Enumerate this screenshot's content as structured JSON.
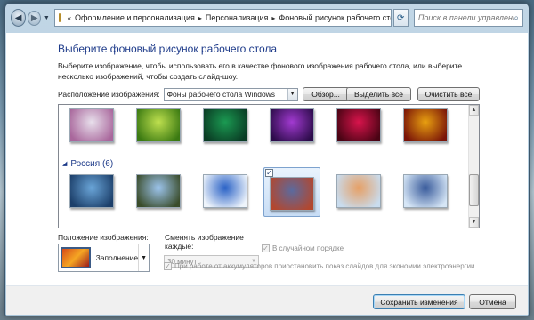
{
  "nav": {
    "breadcrumb": [
      "Оформление и персонализация",
      "Персонализация",
      "Фоновый рисунок рабочего стола"
    ],
    "search_placeholder": "Поиск в панели управления"
  },
  "header": {
    "title": "Выберите фоновый рисунок рабочего стола",
    "description": "Выберите изображение, чтобы использовать его в качестве фонового изображения рабочего стола, или выберите несколько изображений, чтобы создать слайд-шоу."
  },
  "location": {
    "label": "Расположение изображения:",
    "value": "Фоны рабочего стола Windows",
    "browse_label": "Обзор...",
    "select_all_label": "Выделить все",
    "clear_all_label": "Очистить все"
  },
  "gallery": {
    "group_title": "Россия (6)",
    "row1": [
      {
        "name": "white-flower",
        "colors": [
          "#e8e0ec",
          "#a9679c"
        ]
      },
      {
        "name": "green-succulent",
        "colors": [
          "#bfe04f",
          "#3b7a12"
        ]
      },
      {
        "name": "green-leaves",
        "colors": [
          "#1b9a52",
          "#0a3c24"
        ]
      },
      {
        "name": "purple-thistle",
        "colors": [
          "#a23ad1",
          "#2c0c4a"
        ]
      },
      {
        "name": "red-flower",
        "colors": [
          "#d8144c",
          "#4a0414"
        ]
      },
      {
        "name": "orange-leaves",
        "colors": [
          "#e8a010",
          "#7a1408"
        ]
      }
    ],
    "row2": [
      {
        "name": "lake-mountains",
        "colors": [
          "#6aa5d8",
          "#1c3f6a"
        ],
        "checked": false
      },
      {
        "name": "windmill",
        "colors": [
          "#9cc4ec",
          "#3a4c2a"
        ],
        "checked": false
      },
      {
        "name": "snow-sky",
        "colors": [
          "#2a62c6",
          "#eef4fb"
        ],
        "checked": false
      },
      {
        "name": "red-square",
        "colors": [
          "#5b6a9e",
          "#b3472e"
        ],
        "checked": true
      },
      {
        "name": "winter-house",
        "colors": [
          "#e6a066",
          "#c9dcee"
        ],
        "checked": false
      },
      {
        "name": "frozen-lake",
        "colors": [
          "#3a5c9c",
          "#d6e6f6"
        ],
        "checked": false
      }
    ]
  },
  "position": {
    "label": "Положение изображения:",
    "value": "Заполнение"
  },
  "slideshow": {
    "change_label": "Сменять изображение каждые:",
    "interval_value": "30 минут",
    "shuffle_label": "В случайном порядке",
    "battery_label": "При работе от аккумуляторов приостановить показ слайдов для экономии электроэнергии"
  },
  "footer": {
    "save_label": "Сохранить изменения",
    "cancel_label": "Отмена"
  }
}
